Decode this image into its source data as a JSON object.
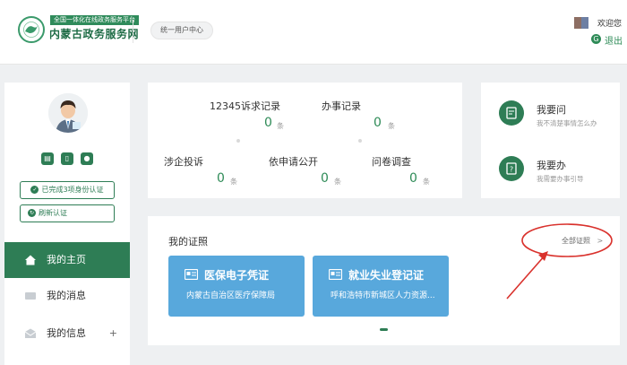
{
  "header": {
    "logo_tag": "全国一体化在线政务服务平台",
    "logo_title": "内蒙古政务服务网",
    "user_center_label": "统一用户中心",
    "welcome_text": "欢迎您",
    "logout_label": "退出"
  },
  "sidebar": {
    "verified_label": "已完成3项身份认证",
    "refresh_label": "刷新认证",
    "nav": [
      {
        "label": "我的主页",
        "icon": "home-icon"
      },
      {
        "label": "我的消息",
        "icon": "message-icon"
      },
      {
        "label": "我的信息",
        "icon": "info-icon",
        "expand": "+"
      }
    ]
  },
  "stats": {
    "complaints": {
      "label": "12345诉求记录",
      "value": "0",
      "unit": "条"
    },
    "affairs": {
      "label": "办事记录",
      "value": "0",
      "unit": "条"
    },
    "enterprise": {
      "label": "涉企投诉",
      "value": "0",
      "unit": "条"
    },
    "disclosure": {
      "label": "依申请公开",
      "value": "0",
      "unit": "条"
    },
    "survey": {
      "label": "问卷调查",
      "value": "0",
      "unit": "条"
    }
  },
  "quick_actions": [
    {
      "title": "我要问",
      "subtitle": "我不清楚事情怎么办",
      "icon": "ask-icon"
    },
    {
      "title": "我要办",
      "subtitle": "我需要办事引导",
      "icon": "handle-icon"
    }
  ],
  "certificates": {
    "section_title": "我的证照",
    "all_link": "全部证照",
    "all_link_arrow": ">",
    "items": [
      {
        "title": "医保电子凭证",
        "issuer": "内蒙古自治区医疗保障局"
      },
      {
        "title": "就业失业登记证",
        "issuer": "呼和浩特市新城区人力资源..."
      }
    ]
  },
  "colors": {
    "brand_green": "#2e7d55",
    "value_green": "#2e8b57",
    "card_blue": "#58a8dc",
    "annotation_red": "#d9312c"
  }
}
